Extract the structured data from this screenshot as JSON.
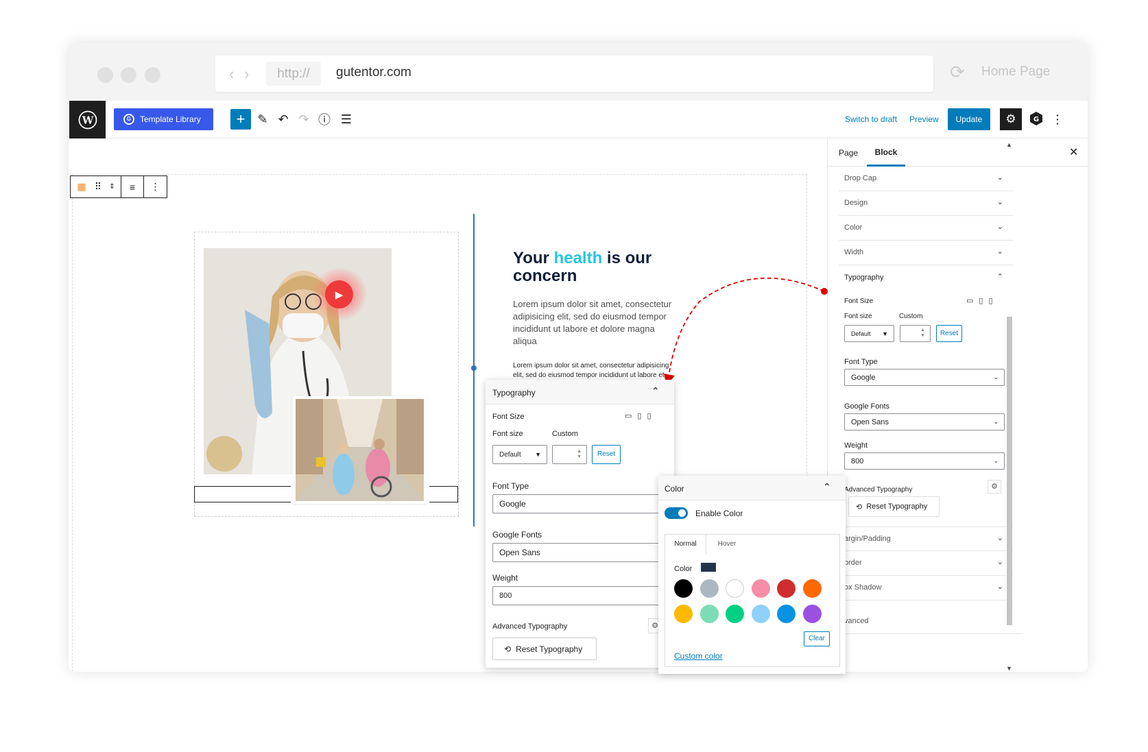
{
  "browser": {
    "url_proto": "http://",
    "url_host": "gutentor.com",
    "home_label": "Home Page",
    "back_icon": "chevron-left-icon",
    "forward_icon": "chevron-right-icon",
    "reload_icon": "reload-icon"
  },
  "editor_header": {
    "template_library_label": "Template Library",
    "switch_to_draft": "Switch to draft",
    "preview": "Preview",
    "update": "Update"
  },
  "content": {
    "headline_pre": "Your ",
    "headline_highlight": "health",
    "headline_post": " is our concern",
    "paragraph1": "Lorem ipsum dolor sit amet, consectetur adipisicing elit, sed do eiusmod tempor incididunt ut labore et dolore magna aliqua",
    "paragraph2": "Lorem ipsum dolor sit amet, consectetur adipisicing elit, sed do eiusmod tempor incididunt ut labore et dolore magna aliqua"
  },
  "sidebar": {
    "tab_page": "Page",
    "tab_block": "Block",
    "rows_top": [
      "Drop Cap",
      "Design",
      "Color",
      "Width"
    ],
    "typography": {
      "title": "Typography",
      "font_size_title": "Font Size",
      "font_size_label": "Font size",
      "custom_label": "Custom",
      "font_size_value": "Default",
      "reset": "Reset",
      "font_type_label": "Font Type",
      "font_type_value": "Google",
      "google_fonts_label": "Google Fonts",
      "google_fonts_value": "Open Sans",
      "weight_label": "Weight",
      "weight_value": "800",
      "advanced_label": "Advanced Typography",
      "reset_typography": "Reset Typography"
    },
    "rows_bottom": [
      "argin/Padding",
      "order",
      "ox Shadow",
      "vanced"
    ]
  },
  "typo_popup": {
    "title": "Typography",
    "font_size_title": "Font Size",
    "font_size_label": "Font size",
    "custom_label": "Custom",
    "font_size_value": "Default",
    "reset": "Reset",
    "font_type_label": "Font Type",
    "font_type_value": "Google",
    "google_fonts_label": "Google Fonts",
    "google_fonts_value": "Open Sans",
    "weight_label": "Weight",
    "weight_value": "800",
    "advanced_label": "Advanced Typography",
    "reset_typography": "Reset Typography"
  },
  "color_popup": {
    "title": "Color",
    "enable_color": "Enable Color",
    "enabled": true,
    "tab_normal": "Normal",
    "tab_hover": "Hover",
    "color_label": "Color",
    "current_color": "#26344a",
    "palette": [
      "#000000",
      "#abb8c3",
      "#ffffff",
      "#f78da7",
      "#cf2e2e",
      "#ff6900",
      "#fcb900",
      "#7bdcb5",
      "#00d084",
      "#8ed1fc",
      "#0693e3",
      "#9b51e0"
    ],
    "clear": "Clear",
    "custom_color": "Custom color"
  },
  "colors": {
    "wp_blue": "#007cba",
    "gutentor_blue": "#3858e9",
    "highlight": "#25c6e0",
    "arrow_red": "#e00000"
  }
}
